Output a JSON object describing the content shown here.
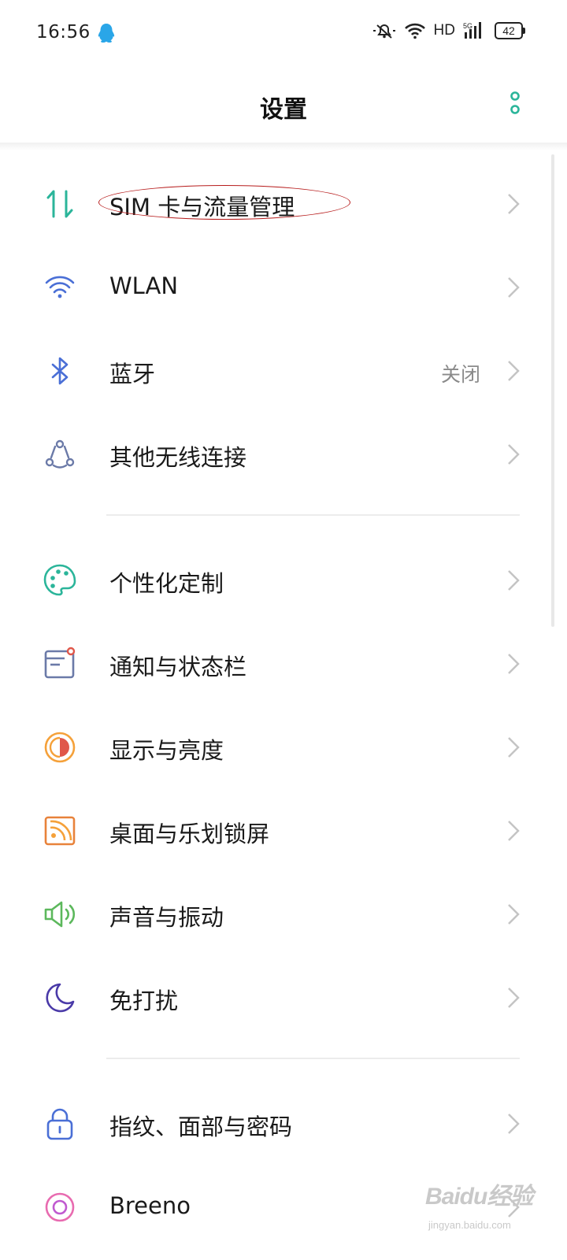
{
  "status_bar": {
    "time": "16:56",
    "network": "HD",
    "signal_tag": "5G",
    "battery": "42"
  },
  "header": {
    "title": "设置"
  },
  "settings": {
    "items": [
      {
        "label": "SIM 卡与流量管理",
        "icon": "data-transfer-icon"
      },
      {
        "label": "WLAN",
        "icon": "wifi-icon"
      },
      {
        "label": "蓝牙",
        "value": "关闭",
        "icon": "bluetooth-icon"
      },
      {
        "label": "其他无线连接",
        "icon": "wireless-connection-icon"
      },
      {
        "label": "个性化定制",
        "icon": "palette-icon"
      },
      {
        "label": "通知与状态栏",
        "icon": "notification-icon"
      },
      {
        "label": "显示与亮度",
        "icon": "brightness-icon"
      },
      {
        "label": "桌面与乐划锁屏",
        "icon": "wallpaper-icon"
      },
      {
        "label": "声音与振动",
        "icon": "speaker-icon"
      },
      {
        "label": "免打扰",
        "icon": "moon-icon"
      },
      {
        "label": "指纹、面部与密码",
        "icon": "lock-icon"
      },
      {
        "label": "Breeno",
        "icon": "breeno-icon"
      }
    ]
  },
  "watermark": {
    "logo": "Baidu经验",
    "url": "jingyan.baidu.com"
  },
  "colors": {
    "teal": "#2bb59a",
    "blue": "#4a6fd6",
    "orange": "#f5a13a",
    "red": "#e0574a",
    "purple": "#4a3aa8",
    "green": "#5cb85c",
    "pink": "#e86bb0"
  }
}
